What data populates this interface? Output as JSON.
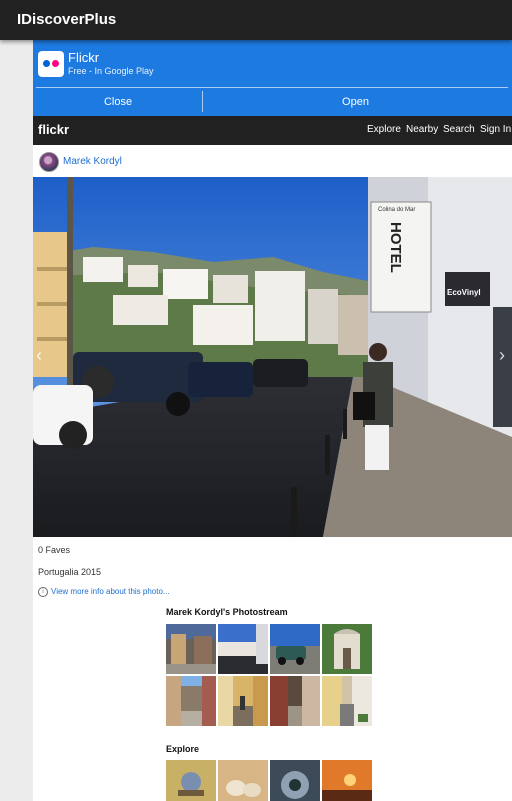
{
  "app": {
    "title": "IDiscoverPlus"
  },
  "banner": {
    "app_name": "Flickr",
    "subtitle": "Free - In Google Play",
    "close_label": "Close",
    "open_label": "Open",
    "colors": {
      "background": "#1d7ae0",
      "logo_blue": "#0063dc",
      "logo_pink": "#ff0084"
    }
  },
  "flickr_header": {
    "logo": "flickr",
    "nav": [
      "Explore",
      "Nearby",
      "Search",
      "Sign In"
    ]
  },
  "photo": {
    "owner": "Marek Kordyl",
    "faves": "0 Faves",
    "title": "Portugalia 2015",
    "more_info": "View more info about this photo...",
    "sign_text": "HOTEL",
    "sign_small": "Colina do Mar",
    "store_text": "EcoVinyl"
  },
  "photostream": {
    "title": "Marek Kordyl's Photostream"
  },
  "explore": {
    "title": "Explore"
  }
}
